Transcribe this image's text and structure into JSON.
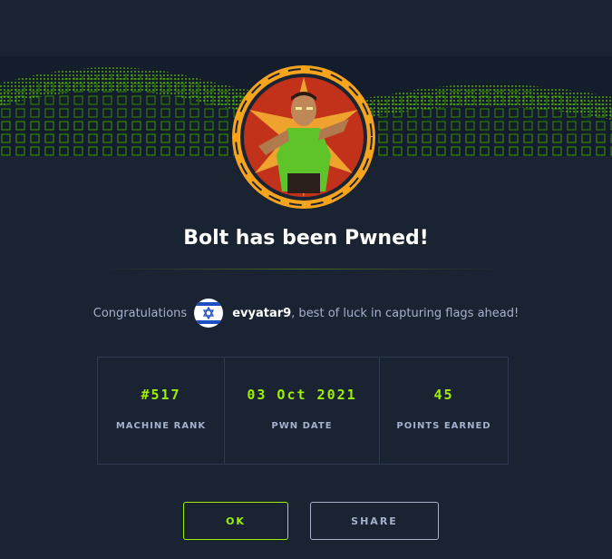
{
  "title": "Bolt has been Pwned!",
  "congrats": {
    "prefix": "Congratulations",
    "username": "evyatar9",
    "suffix": ", best of luck in capturing flags ahead!",
    "flag_icon": "israel-flag-icon"
  },
  "stats": [
    {
      "value": "#517",
      "label": "MACHINE RANK"
    },
    {
      "value": "03 Oct 2021",
      "label": "PWN DATE"
    },
    {
      "value": "45",
      "label": "POINTS EARNED"
    }
  ],
  "buttons": {
    "ok_label": "OK",
    "share_label": "SHARE"
  },
  "colors": {
    "accent": "#9fef00",
    "background": "#1a2332",
    "text": "#a4b1cd",
    "avatar_ring": "#f7a31c"
  },
  "icons": {
    "banner": "green-cube-grid-banner",
    "avatar": "machine-avatar-icon"
  }
}
